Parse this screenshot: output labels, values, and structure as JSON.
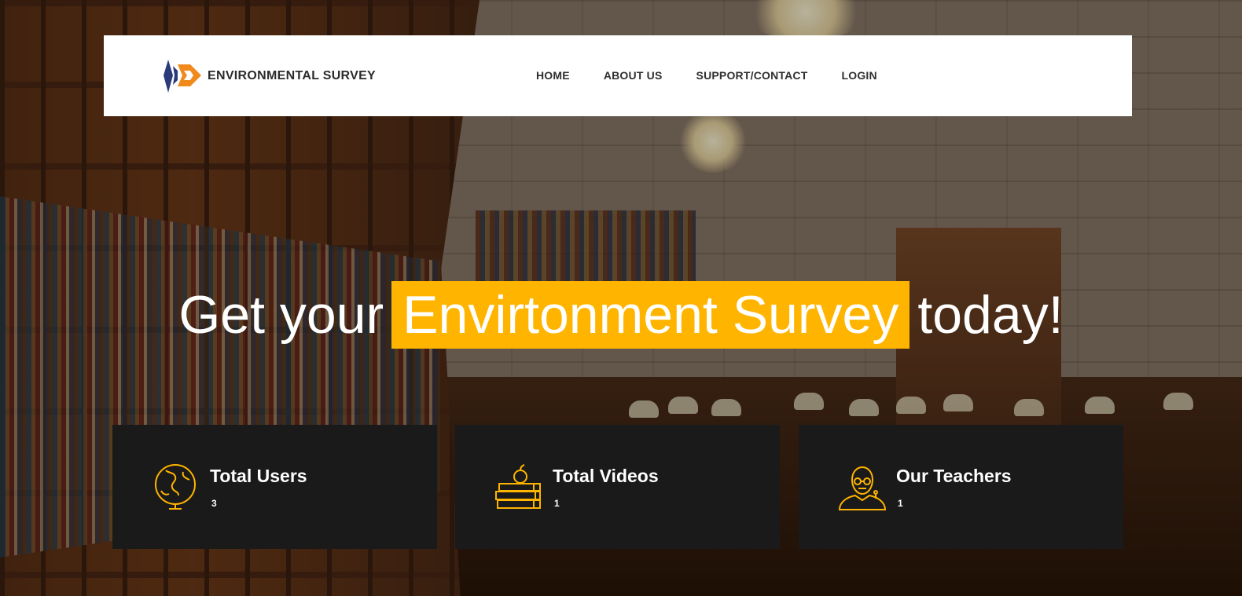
{
  "brand": {
    "name": "ENVIRONMENTAL SURVEY"
  },
  "nav": {
    "items": [
      {
        "label": "HOME"
      },
      {
        "label": "ABOUT US"
      },
      {
        "label": "SUPPORT/CONTACT"
      },
      {
        "label": "LOGIN"
      }
    ]
  },
  "hero": {
    "prefix": "Get your",
    "highlight": "Envirtonment Survey",
    "suffix": "today!"
  },
  "stats": [
    {
      "title": "Total Users",
      "count": "3",
      "icon": "globe-icon"
    },
    {
      "title": "Total Videos",
      "count": "1",
      "icon": "books-apple-icon"
    },
    {
      "title": "Our Teachers",
      "count": "1",
      "icon": "teacher-icon"
    }
  ],
  "colors": {
    "accent": "#ffb400",
    "card_bg": "#1a1a1a",
    "navbar_bg": "#ffffff",
    "logo_blue": "#2b3a7a",
    "logo_orange": "#f08a1c"
  }
}
